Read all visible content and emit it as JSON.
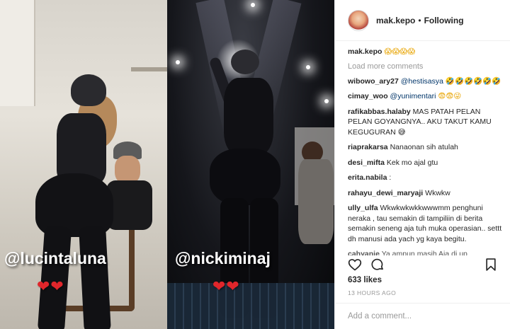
{
  "header": {
    "username": "mak.kepo",
    "separator": "•",
    "follow_status": "Following"
  },
  "media": {
    "left_mention": "@lucintaluna",
    "right_mention": "@nickiminaj",
    "left_hearts": "❤❤",
    "right_hearts": "❤❤"
  },
  "comments": {
    "load_more": "Load more comments",
    "items": [
      {
        "user": "mak.kepo",
        "text": "😱😱😱😱"
      },
      {
        "user": "wibowo_ary27",
        "mention": "@hestisasya",
        "text": "🤣🤣🤣🤣🤣🤣"
      },
      {
        "user": "cimay_woo",
        "mention": "@yunimentari",
        "text": "😨😨😜"
      },
      {
        "user": "rafikabbas.halaby",
        "text": "MAS PATAH PELAN PELAN GOYANGNYA.. AKU TAKUT KAMU KEGUGURAN 😅"
      },
      {
        "user": "riaprakarsa",
        "text": "Nanaonan sih atulah"
      },
      {
        "user": "desi_mifta",
        "text": "Kek mo ajal gtu"
      },
      {
        "user": "erita.nabila",
        "text": ":"
      },
      {
        "user": "rahayu_dewi_maryaji",
        "text": "Wkwkw"
      },
      {
        "user": "ully_ulfa",
        "text": "Wkwkwkwkkwwwmm penghuni neraka , tau semakin di tampiliin di berita semakin seneng aja tuh muka operasian.. settt dh manusi ada yach yg kaya begitu."
      },
      {
        "user": "cahyanie",
        "text": "Ya ampun masih Aja di up"
      }
    ]
  },
  "actions": {
    "like_icon": "heart-outline-icon",
    "comment_icon": "speech-bubble-icon",
    "save_icon": "bookmark-icon"
  },
  "likes": "633 likes",
  "timestamp": "13 HOURS AGO",
  "add_comment": {
    "placeholder": "Add a comment..."
  }
}
